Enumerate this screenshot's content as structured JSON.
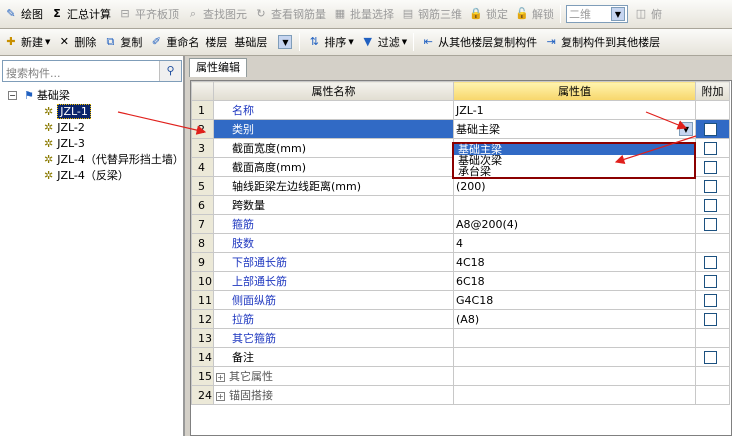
{
  "toolbar1": {
    "items": [
      {
        "label": "绘图",
        "icon": "pencil-icon",
        "enabled": true
      },
      {
        "label": "汇总计算",
        "icon": "sigma-icon",
        "enabled": true
      },
      {
        "label": "平齐板顶",
        "icon": "align-icon",
        "enabled": false
      },
      {
        "label": "查找图元",
        "icon": "find-icon",
        "enabled": false
      },
      {
        "label": "查看钢筋量",
        "icon": "view-icon",
        "enabled": false
      },
      {
        "label": "批量选择",
        "icon": "batch-icon",
        "enabled": false
      },
      {
        "label": "钢筋三维",
        "icon": "3d-icon",
        "enabled": false
      },
      {
        "label": "锁定",
        "icon": "lock-icon",
        "enabled": false
      },
      {
        "label": "解锁",
        "icon": "unlock-icon",
        "enabled": false
      }
    ],
    "view_combo": "二维",
    "trailing": "俯"
  },
  "toolbar2": {
    "new": "新建",
    "delete": "删除",
    "copy": "复制",
    "rename": "重命名",
    "floor_label": "楼层",
    "floor_value": "基础层",
    "sort": "排序",
    "filter": "过滤",
    "copy_from": "从其他楼层复制构件",
    "copy_to": "复制构件到其他楼层"
  },
  "search": {
    "placeholder": "搜索构件..."
  },
  "tree": {
    "root": "基础梁",
    "children": [
      "JZL-1",
      "JZL-2",
      "JZL-3",
      "JZL-4（代替异形挡土墙）",
      "JZL-4（反梁）"
    ]
  },
  "tab": "属性编辑",
  "table": {
    "headers": [
      "属性名称",
      "属性值",
      "附加"
    ],
    "rows": [
      {
        "n": "1",
        "name": "名称",
        "value": "JZL-1",
        "color": "blue",
        "check": false
      },
      {
        "n": "2",
        "name": "类别",
        "value": "基础主梁",
        "color": "blue",
        "check": true
      },
      {
        "n": "3",
        "name": "截面宽度(mm)",
        "value": "",
        "color": "black",
        "check": true
      },
      {
        "n": "4",
        "name": "截面高度(mm)",
        "value": "",
        "color": "black",
        "check": true
      },
      {
        "n": "5",
        "name": "轴线距梁左边线距离(mm)",
        "value": "(200)",
        "color": "black",
        "check": true
      },
      {
        "n": "6",
        "name": "跨数量",
        "value": "",
        "color": "black",
        "check": true
      },
      {
        "n": "7",
        "name": "箍筋",
        "value": "A8@200(4)",
        "color": "blue",
        "check": true
      },
      {
        "n": "8",
        "name": "肢数",
        "value": "4",
        "color": "blue",
        "check": false
      },
      {
        "n": "9",
        "name": "下部通长筋",
        "value": "4C18",
        "color": "blue",
        "check": true
      },
      {
        "n": "10",
        "name": "上部通长筋",
        "value": "6C18",
        "color": "blue",
        "check": true
      },
      {
        "n": "11",
        "name": "侧面纵筋",
        "value": "G4C18",
        "color": "blue",
        "check": true
      },
      {
        "n": "12",
        "name": "拉筋",
        "value": "(A8)",
        "color": "blue",
        "check": true
      },
      {
        "n": "13",
        "name": "其它箍筋",
        "value": "",
        "color": "blue",
        "check": false
      },
      {
        "n": "14",
        "name": "备注",
        "value": "",
        "color": "black",
        "check": true
      },
      {
        "n": "15",
        "name": "其它属性",
        "value": "",
        "color": "gray",
        "check": false,
        "group": true
      },
      {
        "n": "24",
        "name": "锚固搭接",
        "value": "",
        "color": "gray",
        "check": false,
        "group": true
      }
    ]
  },
  "dropdown": {
    "options": [
      "基础主梁",
      "基础次梁",
      "承台梁"
    ],
    "selected": 0
  },
  "colors": {
    "annotation": "#e0201c",
    "selection": "#316ac5"
  }
}
